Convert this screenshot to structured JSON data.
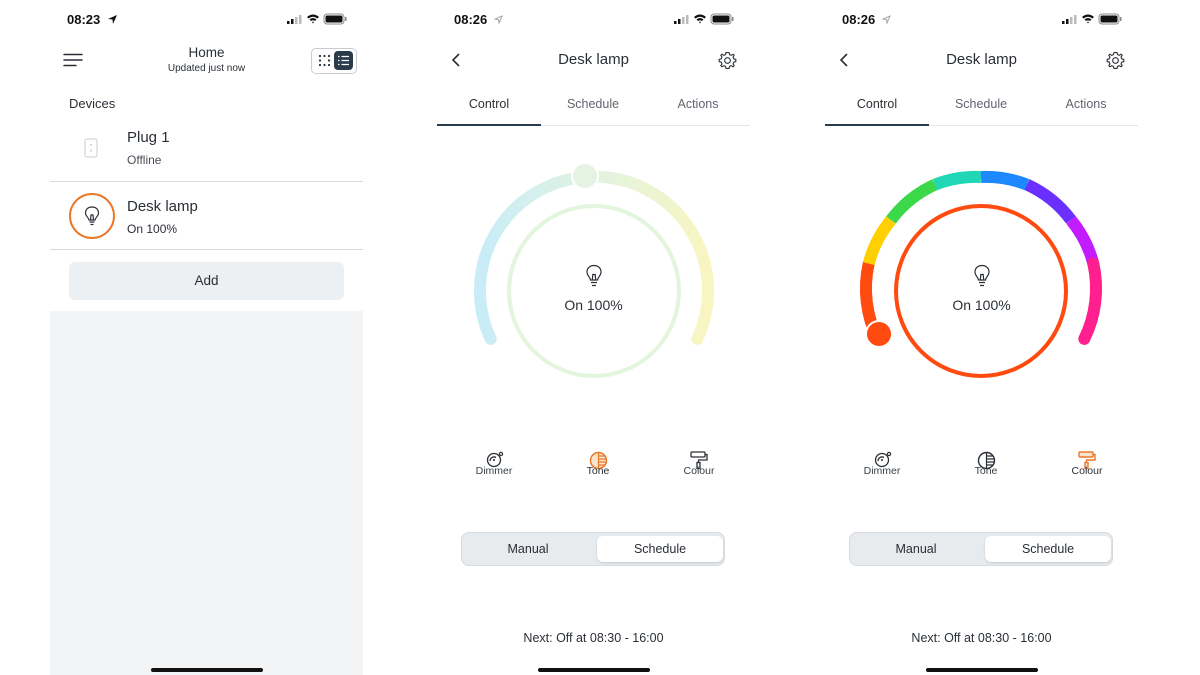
{
  "screen1": {
    "time": "08:23",
    "header": {
      "title": "Home",
      "subtitle": "Updated just now"
    },
    "section_label": "Devices",
    "devices": [
      {
        "name": "Plug 1",
        "status": "Offline",
        "icon": "plug-icon"
      },
      {
        "name": "Desk lamp",
        "status": "On 100%",
        "icon": "bulb-icon"
      }
    ],
    "add_label": "Add"
  },
  "screen2": {
    "time": "08:26",
    "title": "Desk lamp",
    "tabs": [
      "Control",
      "Schedule",
      "Actions"
    ],
    "active_tab": "Control",
    "dial_status": "On 100%",
    "modes": [
      {
        "label": "Dimmer",
        "icon": "dimmer-icon"
      },
      {
        "label": "Tone",
        "icon": "tone-icon"
      },
      {
        "label": "Colour",
        "icon": "colour-roller-icon"
      }
    ],
    "active_mode": "Tone",
    "segment": [
      "Manual",
      "Schedule"
    ],
    "segment_selected": "Schedule",
    "next_text": "Next: Off at 08:30 - 16:00"
  },
  "screen3": {
    "time": "08:26",
    "title": "Desk lamp",
    "tabs": [
      "Control",
      "Schedule",
      "Actions"
    ],
    "active_tab": "Control",
    "dial_status": "On 100%",
    "modes": [
      {
        "label": "Dimmer",
        "icon": "dimmer-icon"
      },
      {
        "label": "Tone",
        "icon": "tone-icon"
      },
      {
        "label": "Colour",
        "icon": "colour-roller-icon"
      }
    ],
    "active_mode": "Colour",
    "segment": [
      "Manual",
      "Schedule"
    ],
    "segment_selected": "Schedule",
    "next_text": "Next: Off at 08:30 - 16:00"
  },
  "colors": {
    "accent_orange": "#e8782a",
    "lamp_ring_orange": "#ff4a10",
    "tone_ring": "#e3f5dd",
    "text_dark": "#2a2f36",
    "tab_underline": "#2a3b4c"
  }
}
